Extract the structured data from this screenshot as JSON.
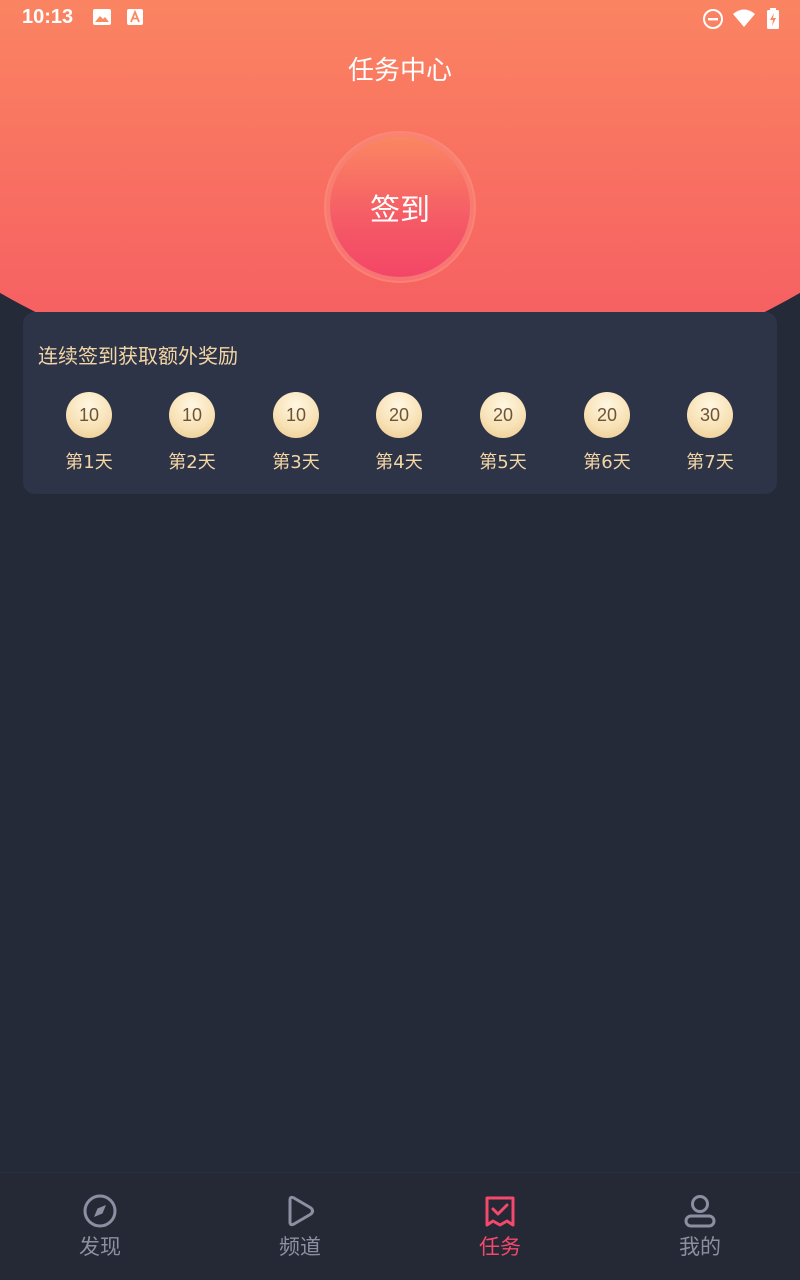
{
  "status_bar": {
    "time": "10:13",
    "icons": [
      "image-icon",
      "a-icon",
      "dnd-icon",
      "wifi-icon",
      "battery-icon"
    ]
  },
  "header": {
    "title": "任务中心"
  },
  "signin": {
    "label": "签到"
  },
  "reward": {
    "title": "连续签到获取额外奖励",
    "days": [
      {
        "coins": "10",
        "label": "第1天"
      },
      {
        "coins": "10",
        "label": "第2天"
      },
      {
        "coins": "10",
        "label": "第3天"
      },
      {
        "coins": "20",
        "label": "第4天"
      },
      {
        "coins": "20",
        "label": "第5天"
      },
      {
        "coins": "20",
        "label": "第6天"
      },
      {
        "coins": "30",
        "label": "第7天"
      }
    ]
  },
  "nav": {
    "items": [
      {
        "label": "发现",
        "icon": "compass-icon",
        "active": false
      },
      {
        "label": "频道",
        "icon": "play-icon",
        "active": false
      },
      {
        "label": "任务",
        "icon": "task-check-icon",
        "active": true
      },
      {
        "label": "我的",
        "icon": "user-icon",
        "active": false
      }
    ]
  },
  "colors": {
    "accent": "#f4496c",
    "gold_text": "#f3d6a5",
    "background": "#252a38",
    "card": "#2e3447",
    "nav_inactive": "#8c8fa1"
  }
}
